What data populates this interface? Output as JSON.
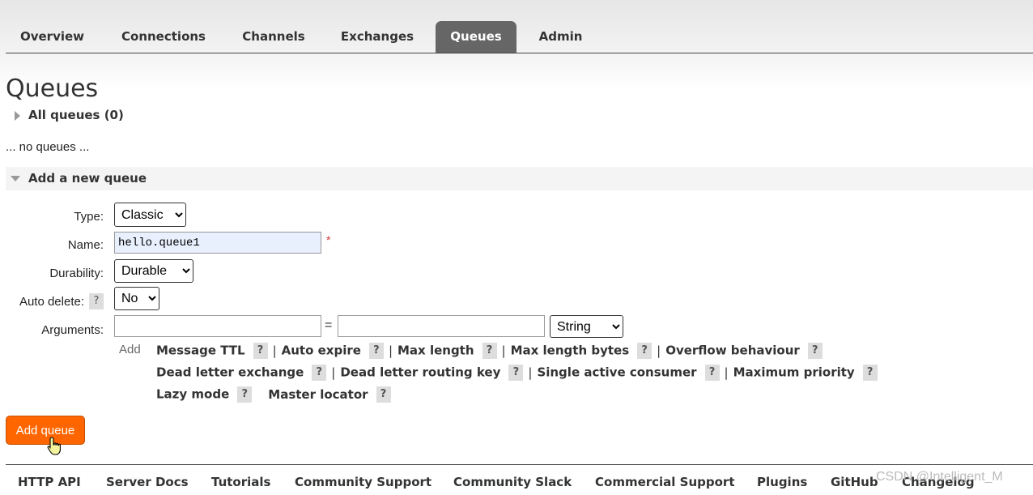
{
  "nav": {
    "tabs": [
      {
        "label": "Overview"
      },
      {
        "label": "Connections"
      },
      {
        "label": "Channels"
      },
      {
        "label": "Exchanges"
      },
      {
        "label": "Queues",
        "active": true
      },
      {
        "label": "Admin"
      }
    ]
  },
  "page": {
    "title": "Queues",
    "all_queues_label": "All queues (0)",
    "no_queues_text": "... no queues ...",
    "add_section_label": "Add a new queue"
  },
  "form": {
    "type": {
      "label": "Type:",
      "value": "Classic"
    },
    "name": {
      "label": "Name:",
      "value": "hello.queue1",
      "required_mark": "*"
    },
    "durability": {
      "label": "Durability:",
      "value": "Durable"
    },
    "auto_delete": {
      "label": "Auto delete:",
      "help": "?",
      "value": "No"
    },
    "arguments": {
      "label": "Arguments:",
      "equals": "=",
      "type_value": "String",
      "add_label": "Add",
      "help": "?",
      "separator": "|",
      "options": [
        "Message TTL",
        "Auto expire",
        "Max length",
        "Max length bytes",
        "Overflow behaviour",
        "Dead letter exchange",
        "Dead letter routing key",
        "Single active consumer",
        "Maximum priority",
        "Lazy mode",
        "Master locator"
      ]
    },
    "submit_label": "Add queue"
  },
  "footer": {
    "links": [
      "HTTP API",
      "Server Docs",
      "Tutorials",
      "Community Support",
      "Community Slack",
      "Commercial Support",
      "Plugins",
      "GitHub",
      "Changelog"
    ]
  },
  "watermark": "CSDN @Intelligent_M",
  "colors": {
    "accent": "#ff6600",
    "active_tab": "#666666"
  }
}
